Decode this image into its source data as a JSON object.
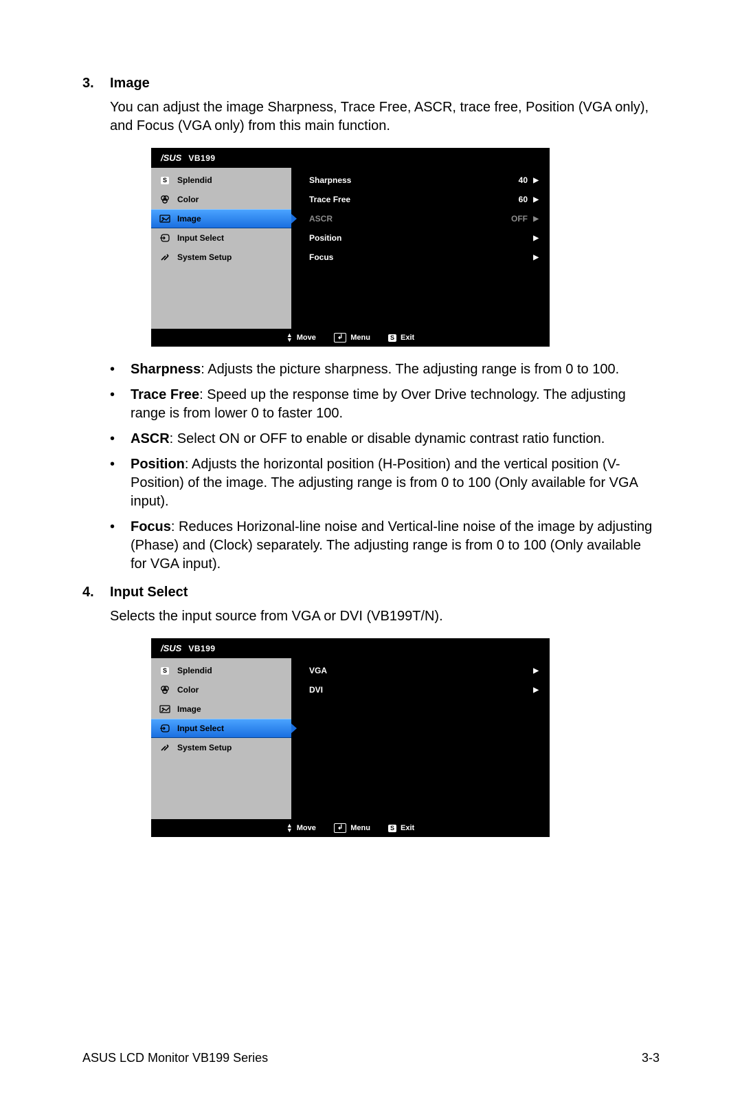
{
  "sections": {
    "image": {
      "num": "3.",
      "title": "Image",
      "desc": "You can adjust the image Sharpness, Trace Free, ASCR, trace free, Position (VGA only), and Focus (VGA only) from this main function."
    },
    "input_select": {
      "num": "4.",
      "title": "Input Select",
      "desc": "Selects the input source from VGA or DVI (VB199T/N)."
    }
  },
  "bullets": {
    "sharpness": {
      "term": "Sharpness",
      "text": ": Adjusts the picture sharpness. The adjusting range is from 0 to 100."
    },
    "tracefree": {
      "term": "Trace Free",
      "text": ": Speed up the response time by Over Drive technology. The adjusting range is from lower 0 to faster 100."
    },
    "ascr": {
      "term": "ASCR",
      "text": ": Select ON or OFF to enable or disable dynamic contrast ratio function."
    },
    "position": {
      "term": "Position",
      "text": ": Adjusts the horizontal position (H-Position) and the vertical position (V-Position) of the image. The adjusting range is from 0 to 100 (Only available for VGA input)."
    },
    "focus": {
      "term": "Focus",
      "text": ": Reduces Horizonal-line noise and Vertical-line noise of the image by adjusting (Phase) and (Clock) separately. The adjusting range is from 0 to 100 (Only available for VGA input)."
    }
  },
  "osd": {
    "brand": "/SUS",
    "model": "VB199",
    "menu": {
      "splendid": "Splendid",
      "color": "Color",
      "image": "Image",
      "input": "Input Select",
      "system": "System Setup"
    },
    "image_panel": {
      "sharpness": {
        "label": "Sharpness",
        "value": "40"
      },
      "tracefree": {
        "label": "Trace Free",
        "value": "60"
      },
      "ascr": {
        "label": "ASCR",
        "value": "OFF"
      },
      "position": {
        "label": "Position"
      },
      "focus": {
        "label": "Focus"
      }
    },
    "input_panel": {
      "vga": "VGA",
      "dvi": "DVI"
    },
    "footer": {
      "move": "Move",
      "menu": "Menu",
      "exit": "Exit",
      "s": "S"
    }
  },
  "page_footer": {
    "left": "ASUS LCD Monitor VB199 Series",
    "right": "3-3"
  },
  "glyph": {
    "tri": "▶",
    "dot": "•"
  }
}
